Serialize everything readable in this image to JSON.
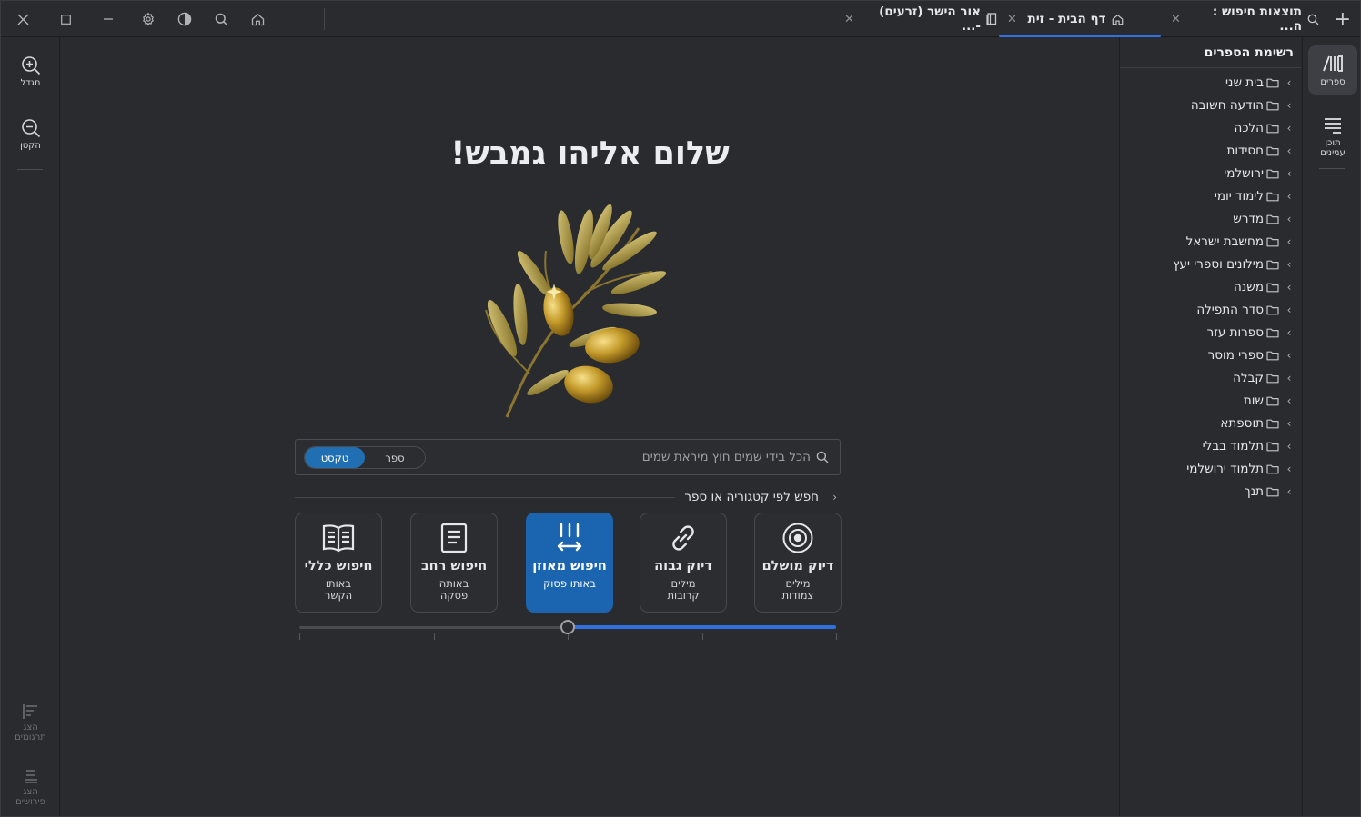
{
  "window": {
    "close_icon": "close-icon",
    "maximize_icon": "maximize-icon",
    "minimize_icon": "minimize-icon"
  },
  "toolbar": {
    "settings_icon": "gear-icon",
    "contrast_icon": "contrast-icon",
    "search_icon": "search-icon",
    "home_icon": "home-icon"
  },
  "tabs": [
    {
      "label": "תוצאות חיפוש : ה...",
      "icon": "search-icon",
      "active": false
    },
    {
      "label": "דף הבית - זית",
      "icon": "home-icon",
      "active": true
    },
    {
      "label": "אור הישר (זרעים) -...",
      "icon": "book-icon",
      "active": false
    }
  ],
  "left_rail": {
    "zoom_in": "תגדל",
    "zoom_out": "הקטן",
    "show_translations": "הצג תרגומים",
    "show_commentaries": "הצג פירושים"
  },
  "right_rail": {
    "books": "ספרים",
    "toc": "תוכן עניינים"
  },
  "books_panel": {
    "title": "רשימת הספרים",
    "items": [
      "בית שני",
      "הודעה חשובה",
      "הלכה",
      "חסידות",
      "ירושלמי",
      "לימוד יומי",
      "מדרש",
      "מחשבת ישראל",
      "מילונים וספרי יעץ",
      "משנה",
      "סדר התפילה",
      "ספרות עזר",
      "ספרי מוסר",
      "קבלה",
      "שות",
      "תוספתא",
      "תלמוד בבלי",
      "תלמוד ירושלמי",
      "תנך"
    ]
  },
  "main": {
    "greeting": "שלום אליהו גמבש!",
    "search": {
      "placeholder": "הכל בידי שמים חוץ מיראת שמים",
      "mode_text": "טקסט",
      "mode_book": "ספר",
      "selected_mode": "טקסט"
    },
    "category_search": "חפש לפי קטגוריה או ספר",
    "cards": [
      {
        "title": "דיוק מושלם",
        "subtitle": "מילים צמודות",
        "icon": "target-icon"
      },
      {
        "title": "דיוק גבוה",
        "subtitle": "מילים קרובות",
        "icon": "link-icon"
      },
      {
        "title": "חיפוש מאוזן",
        "subtitle": "באותו פסוק",
        "icon": "balance-icon"
      },
      {
        "title": "חיפוש רחב",
        "subtitle": "באותה פסקה",
        "icon": "document-icon"
      },
      {
        "title": "חיפוש כללי",
        "subtitle": "באותו הקשר",
        "icon": "open-book-icon"
      }
    ],
    "selected_card": "חיפוש מאוזן",
    "slider": {
      "steps": 5,
      "value_fraction": 0.5
    }
  },
  "colors": {
    "background": "#2a2b2e",
    "accent": "#2f6fe0",
    "selected_card": "#1a64b0",
    "toggle_on": "#1f6fb2"
  }
}
